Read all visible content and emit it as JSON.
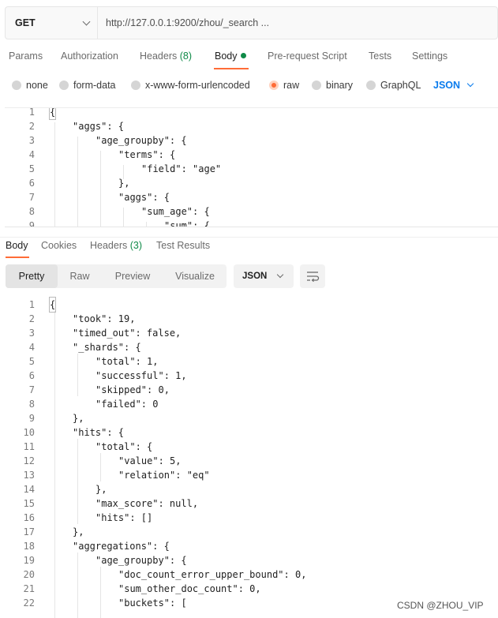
{
  "request": {
    "method": "GET",
    "url": "http://127.0.0.1:9200/zhou/_search ..."
  },
  "request_tabs": {
    "params": "Params",
    "authorization": "Authorization",
    "headers": "Headers",
    "headers_count": "(8)",
    "body": "Body",
    "prerequest": "Pre-request Script",
    "tests": "Tests",
    "settings": "Settings"
  },
  "body_types": {
    "none": "none",
    "form_data": "form-data",
    "urlencoded": "x-www-form-urlencoded",
    "raw": "raw",
    "binary": "binary",
    "graphql": "GraphQL",
    "format": "JSON",
    "selected": "raw"
  },
  "request_body": {
    "lines": [
      {
        "n": "1",
        "text": "{"
      },
      {
        "n": "2",
        "text": "\"aggs\": {"
      },
      {
        "n": "3",
        "text": "\"age_groupby\": {"
      },
      {
        "n": "4",
        "text": "\"terms\": {"
      },
      {
        "n": "5",
        "text": "\"field\": \"age\""
      },
      {
        "n": "6",
        "text": "},"
      },
      {
        "n": "7",
        "text": "\"aggs\": {"
      },
      {
        "n": "8",
        "text": "\"sum_age\": {"
      },
      {
        "n": "9",
        "text": "\"sum\": {"
      }
    ]
  },
  "response_tabs": {
    "body": "Body",
    "cookies": "Cookies",
    "headers": "Headers",
    "headers_count": "(3)",
    "test_results": "Test Results"
  },
  "view_modes": {
    "pretty": "Pretty",
    "raw": "Raw",
    "preview": "Preview",
    "visualize": "Visualize",
    "format": "JSON"
  },
  "response_body": {
    "lines": [
      {
        "n": "1",
        "text": "{"
      },
      {
        "n": "2",
        "text": "\"took\": 19,"
      },
      {
        "n": "3",
        "text": "\"timed_out\": false,"
      },
      {
        "n": "4",
        "text": "\"_shards\": {"
      },
      {
        "n": "5",
        "text": "\"total\": 1,"
      },
      {
        "n": "6",
        "text": "\"successful\": 1,"
      },
      {
        "n": "7",
        "text": "\"skipped\": 0,"
      },
      {
        "n": "8",
        "text": "\"failed\": 0"
      },
      {
        "n": "9",
        "text": "},"
      },
      {
        "n": "10",
        "text": "\"hits\": {"
      },
      {
        "n": "11",
        "text": "\"total\": {"
      },
      {
        "n": "12",
        "text": "\"value\": 5,"
      },
      {
        "n": "13",
        "text": "\"relation\": \"eq\""
      },
      {
        "n": "14",
        "text": "},"
      },
      {
        "n": "15",
        "text": "\"max_score\": null,"
      },
      {
        "n": "16",
        "text": "\"hits\": []"
      },
      {
        "n": "17",
        "text": "},"
      },
      {
        "n": "18",
        "text": "\"aggregations\": {"
      },
      {
        "n": "19",
        "text": "\"age_groupby\": {"
      },
      {
        "n": "20",
        "text": "\"doc_count_error_upper_bound\": 0,"
      },
      {
        "n": "21",
        "text": "\"sum_other_doc_count\": 0,"
      },
      {
        "n": "22",
        "text": "\"buckets\": ["
      }
    ]
  },
  "watermark": "CSDN @ZHOU_VIP",
  "colors": {
    "accent": "#ff6c37",
    "link_blue": "#097bed",
    "success_green": "#0f8a48"
  },
  "icons": {
    "method_dropdown": "chevron-down-icon",
    "format_dropdown": "chevron-down-icon",
    "wrap": "wrap-lines-icon",
    "body_dot": "status-dot-icon"
  }
}
